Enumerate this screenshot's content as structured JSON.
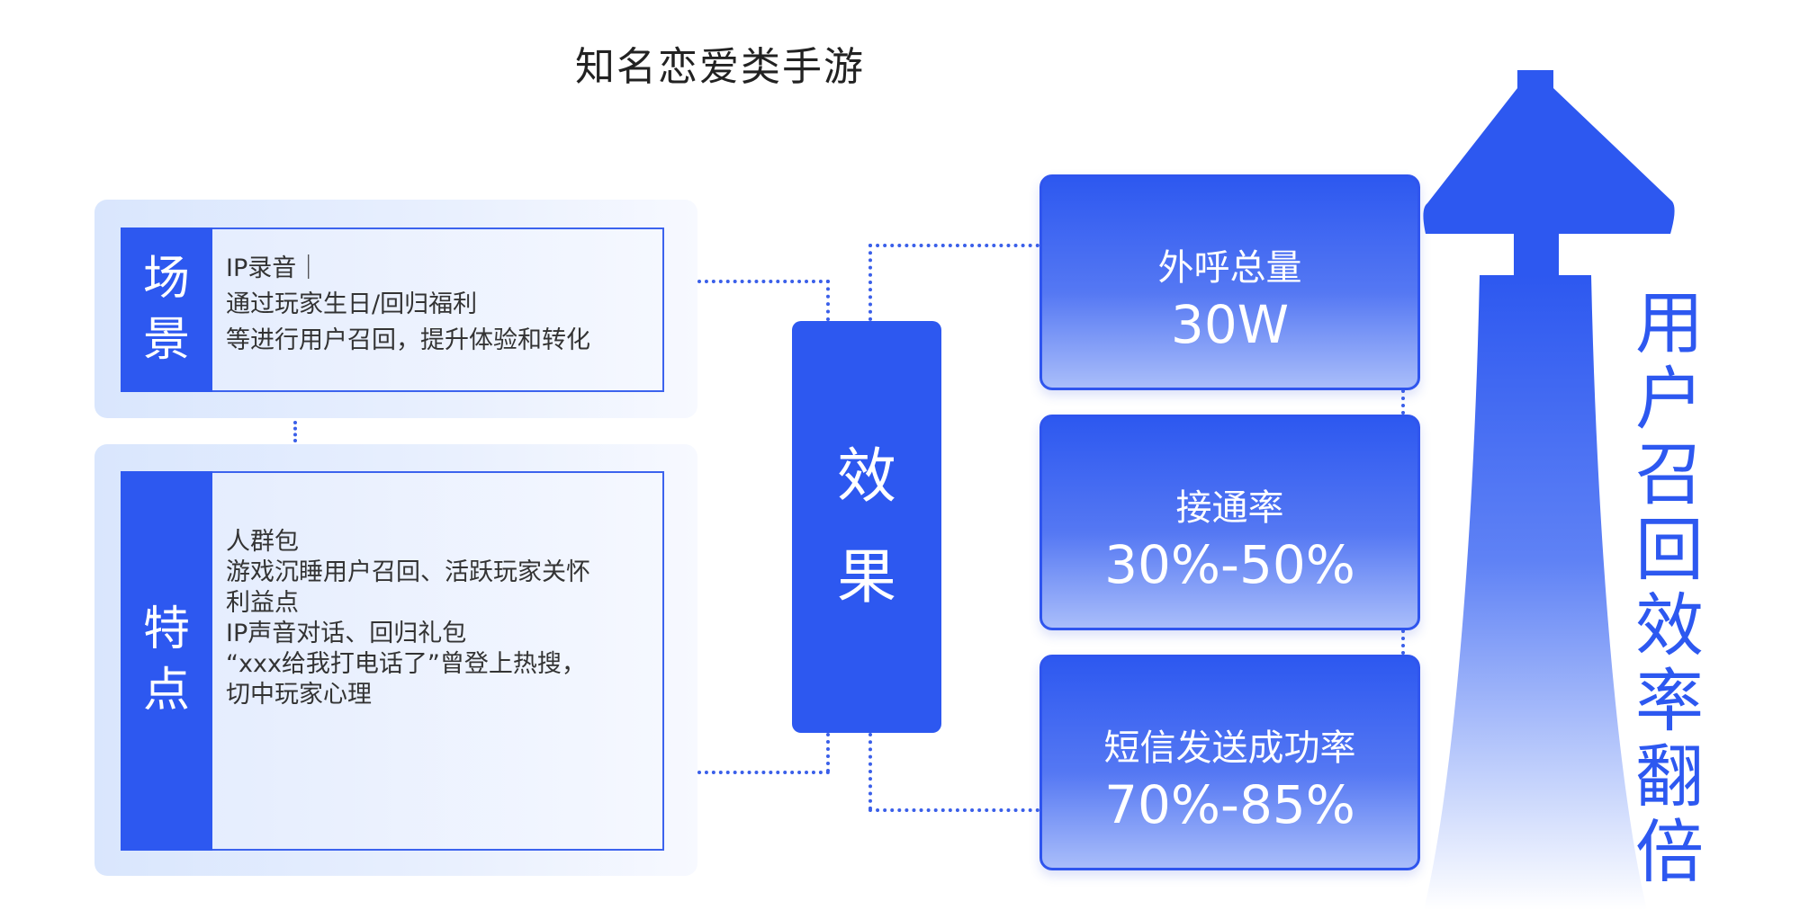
{
  "title": "知名恋爱类手游",
  "scene": {
    "tag": [
      "场",
      "景"
    ],
    "lines": [
      "IP录音｜",
      "通过玩家生日/回归福利",
      "等进行用户召回，提升体验和转化"
    ]
  },
  "features": {
    "tag": [
      "特",
      "点"
    ],
    "lines": [
      "人群包",
      "游戏沉睡用户召回、活跃玩家关怀",
      "利益点",
      "IP声音对话、回归礼包",
      "“xxx给我打电话了”曾登上热搜，",
      "切中玩家心理"
    ]
  },
  "effect": {
    "chars": [
      "效",
      "果"
    ]
  },
  "metrics": [
    {
      "label": "外呼总量",
      "value": "30W"
    },
    {
      "label": "接通率",
      "value": "30%-50%"
    },
    {
      "label": "短信发送成功率",
      "value": "70%-85%"
    }
  ],
  "result": {
    "chars": [
      "用",
      "户",
      "召",
      "回",
      "效",
      "率",
      "翻",
      "倍"
    ]
  },
  "colors": {
    "primary": "#2d58f0",
    "frame": "#e4ecfd",
    "text": "#333333"
  }
}
